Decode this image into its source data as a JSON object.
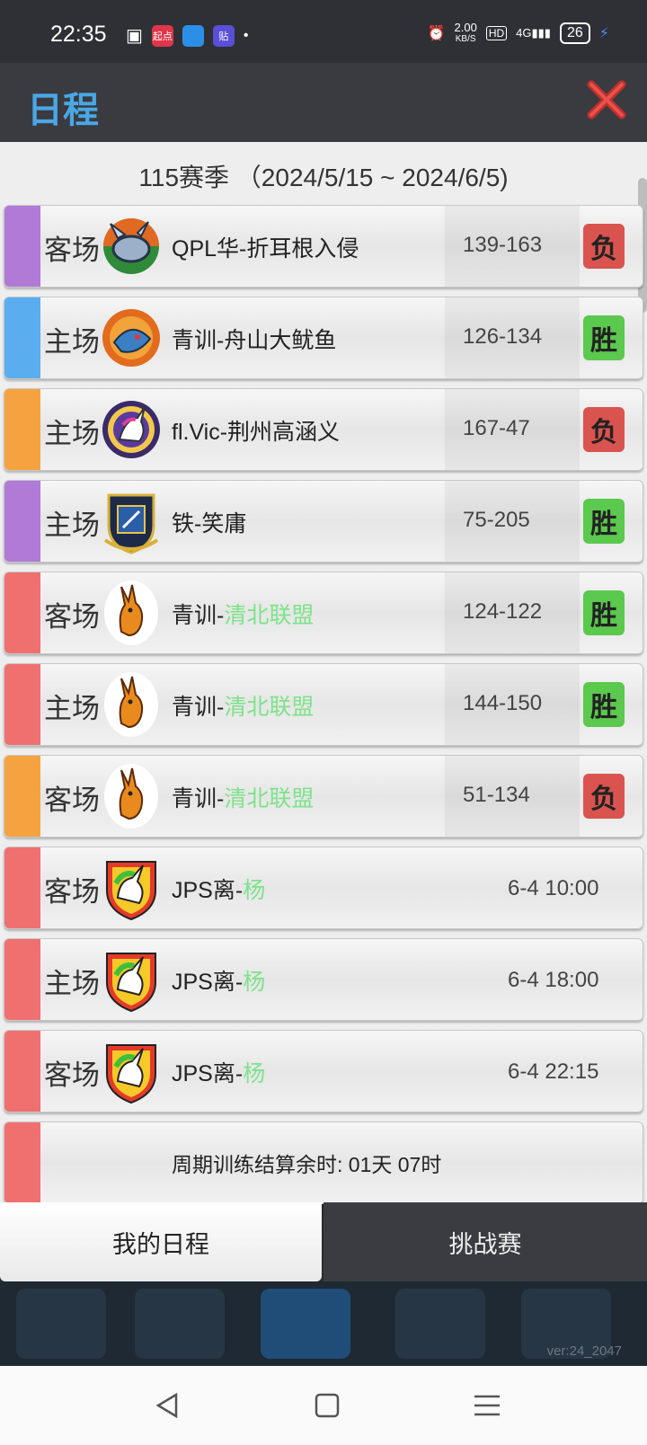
{
  "status_bar": {
    "time": "22:35",
    "apps": [
      "起点",
      "",
      "贴"
    ],
    "net_speed": "2.00",
    "net_unit": "KB/S",
    "hd": "HD",
    "signal": "4G",
    "battery": "26"
  },
  "header": {
    "title": "日程"
  },
  "season": {
    "label": "115赛季 （2024/5/15 ~ 2024/6/5)"
  },
  "rows": [
    {
      "venue": "客场",
      "team": "QPL华-折耳根入侵",
      "team_prefix": "QPL华-折耳根入侵",
      "team_highlight": "",
      "score": "139-163",
      "result": "负",
      "stripe": "#b07ad6",
      "logo": "bunny-knight"
    },
    {
      "venue": "主场",
      "team_prefix": "青训-舟山大鱿鱼",
      "team_highlight": "",
      "score": "126-134",
      "result": "胜",
      "stripe": "#5aaef0",
      "logo": "dragon"
    },
    {
      "venue": "主场",
      "team_prefix": "fl.Vic-荆州高涵义",
      "team_highlight": "",
      "score": "167-47",
      "result": "负",
      "stripe": "#f5a340",
      "logo": "unicorn-purple"
    },
    {
      "venue": "主场",
      "team_prefix": "铁-笑庸",
      "team_highlight": "",
      "score": "75-205",
      "result": "胜",
      "stripe": "#b07ad6",
      "logo": "crest-blue"
    },
    {
      "venue": "客场",
      "team_prefix": "青训-",
      "team_highlight": "清北联盟",
      "score": "124-122",
      "result": "胜",
      "stripe": "#f07070",
      "logo": "kangaroo"
    },
    {
      "venue": "主场",
      "team_prefix": "青训-",
      "team_highlight": "清北联盟",
      "score": "144-150",
      "result": "胜",
      "stripe": "#f07070",
      "logo": "kangaroo"
    },
    {
      "venue": "客场",
      "team_prefix": "青训-",
      "team_highlight": "清北联盟",
      "score": "51-134",
      "result": "负",
      "stripe": "#f5a340",
      "logo": "kangaroo"
    },
    {
      "venue": "客场",
      "team_prefix": "JPS离-",
      "team_highlight": "杨",
      "time": "6-4 10:00",
      "stripe": "#f07070",
      "logo": "unicorn-shield"
    },
    {
      "venue": "主场",
      "team_prefix": "JPS离-",
      "team_highlight": "杨",
      "time": "6-4 18:00",
      "stripe": "#f07070",
      "logo": "unicorn-shield"
    },
    {
      "venue": "客场",
      "team_prefix": "JPS离-",
      "team_highlight": "杨",
      "time": "6-4 22:15",
      "stripe": "#f07070",
      "logo": "unicorn-shield"
    }
  ],
  "notice": {
    "text": "周期训练结算余时: 01天 07时",
    "stripe": "#f07070"
  },
  "tabs": {
    "my_schedule": "我的日程",
    "challenge": "挑战赛"
  },
  "version": "ver:24_2047",
  "colors": {
    "title_blue": "#4aa7e6",
    "win_green": "#5bc84e",
    "loss_red": "#d9534f",
    "highlight_green": "#7de38a"
  }
}
